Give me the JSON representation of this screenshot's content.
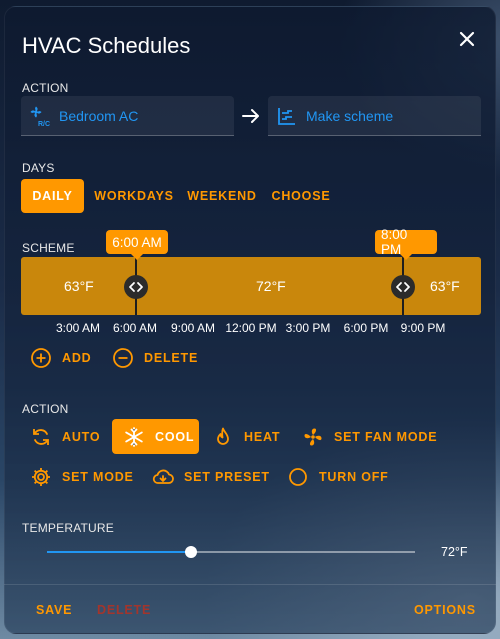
{
  "dialog": {
    "title": "HVAC Schedules"
  },
  "action_section": {
    "label": "ACTION",
    "entity": "Bedroom AC",
    "scheme": "Make scheme"
  },
  "days": {
    "label": "DAYS",
    "options": [
      "DAILY",
      "WORKDAYS",
      "WEEKEND",
      "CHOOSE"
    ],
    "selected": "DAILY"
  },
  "scheme": {
    "label": "SCHEME",
    "markers": [
      "6:00 AM",
      "8:00 PM"
    ],
    "segments": [
      "63°F",
      "72°F",
      "63°F"
    ],
    "axis_ticks": [
      "3:00 AM",
      "6:00 AM",
      "9:00 AM",
      "12:00 PM",
      "3:00 PM",
      "6:00 PM",
      "9:00 PM"
    ],
    "add_label": "ADD",
    "delete_label": "DELETE"
  },
  "mode_section": {
    "label": "ACTION",
    "modes": [
      "AUTO",
      "COOL",
      "HEAT",
      "SET FAN MODE",
      "SET MODE",
      "SET PRESET",
      "TURN OFF"
    ],
    "selected": "COOL"
  },
  "temperature": {
    "label": "TEMPERATURE",
    "value": "72°F",
    "slider_fraction": 0.39
  },
  "footer": {
    "save": "SAVE",
    "delete": "DELETE",
    "options": "OPTIONS"
  },
  "colors": {
    "accent": "#ff9800",
    "entity_blue": "#2196f3",
    "scheme_bar": "#c9870c",
    "delete_red": "#a3352c"
  }
}
